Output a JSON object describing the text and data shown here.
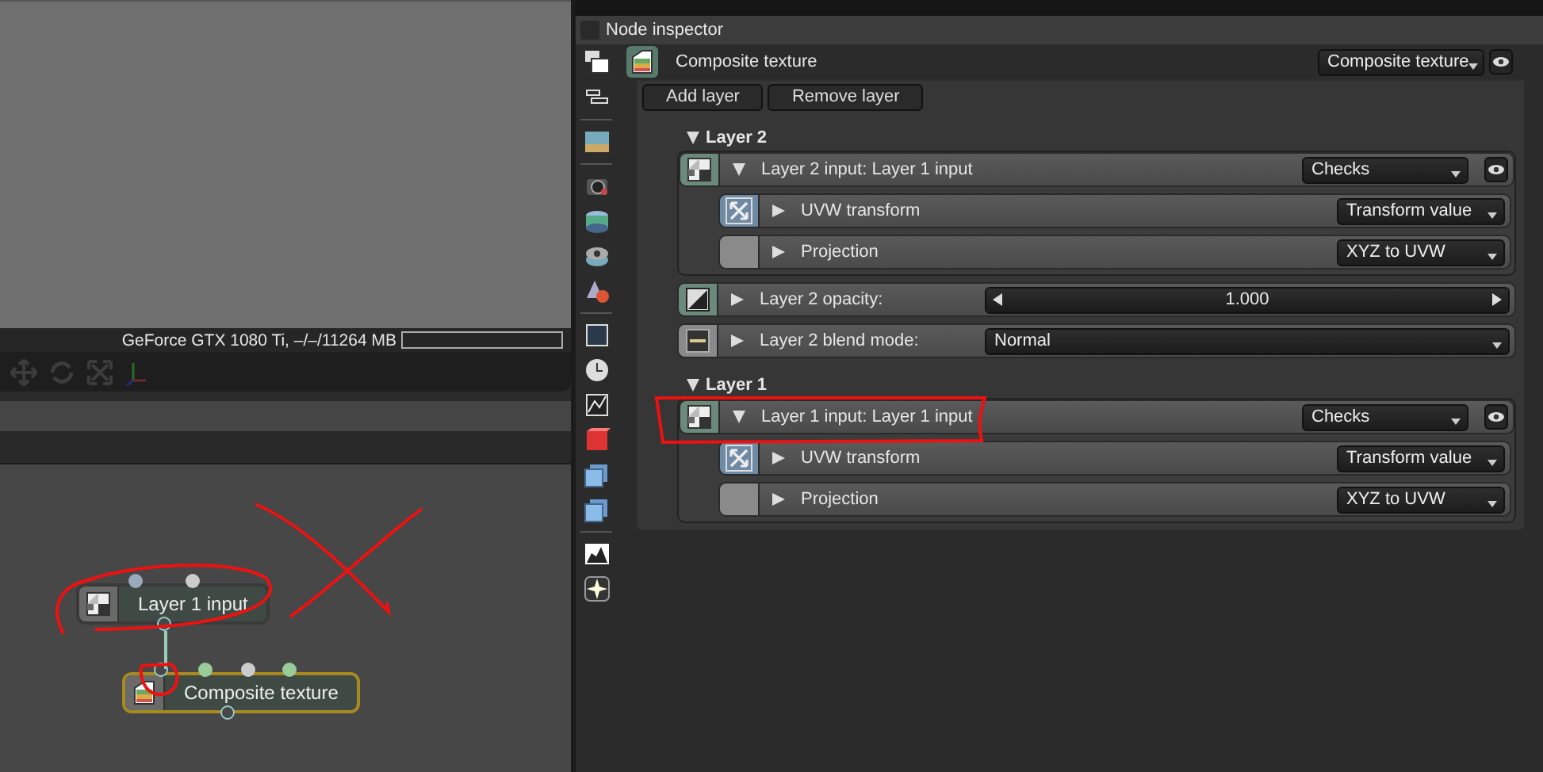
{
  "viewport": {
    "status": "GeForce GTX 1080 Ti, –/–/11264 MB"
  },
  "node_graph": {
    "nodes": [
      {
        "label": "Layer 1 input",
        "kind": "input",
        "selected": false
      },
      {
        "label": "Composite texture",
        "kind": "composite",
        "selected": true
      }
    ]
  },
  "inspector": {
    "title": "Node inspector",
    "checked": false,
    "node": {
      "title": "Composite texture",
      "type": "Composite texture"
    },
    "buttons": [
      "Add layer",
      "Remove layer"
    ],
    "layers": [
      {
        "heading": "Layer 2",
        "expanded": true,
        "rows": [
          {
            "kind": "input",
            "label": "Layer 2 input: Layer 1 input",
            "expanded": true,
            "value": "Checks",
            "children": [
              {
                "kind": "transform",
                "label": "UVW transform",
                "expanded": false,
                "value": "Transform value"
              },
              {
                "kind": "projection",
                "label": "Projection",
                "expanded": false,
                "value": "XYZ to UVW"
              }
            ]
          },
          {
            "kind": "slider",
            "label": "Layer 2 opacity:",
            "expanded": false,
            "value": "1.000",
            "level": 1
          },
          {
            "kind": "blend",
            "label": "Layer 2 blend mode:",
            "expanded": false,
            "value": "Normal"
          }
        ]
      },
      {
        "heading": "Layer 1",
        "expanded": true,
        "rows": [
          {
            "kind": "input",
            "label": "Layer 1 input: Layer 1 input",
            "expanded": true,
            "value": "Checks",
            "children": [
              {
                "kind": "transform",
                "label": "UVW transform",
                "expanded": false,
                "value": "Transform value"
              },
              {
                "kind": "projection",
                "label": "Projection",
                "expanded": false,
                "value": "XYZ to UVW"
              }
            ]
          }
        ]
      }
    ]
  }
}
